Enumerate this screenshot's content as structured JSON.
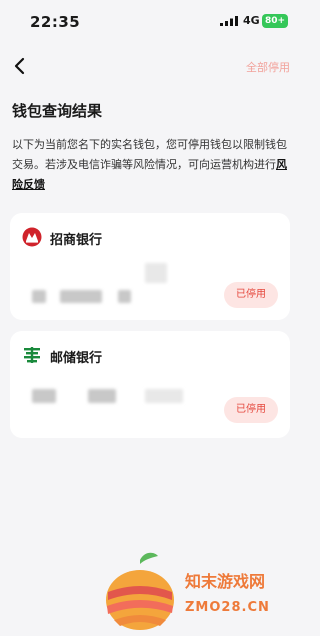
{
  "status_bar": {
    "time": "22:35",
    "network": "4G",
    "battery": "80+"
  },
  "nav": {
    "stop_all_label": "全部停用"
  },
  "page": {
    "title": "钱包查询结果",
    "description_text": "以下为当前您名下的实名钱包，您可停用钱包以限制钱包交易。若涉及电信诈骗等风险情况，可向运营机构进行",
    "feedback_link": "风险反馈"
  },
  "wallets": [
    {
      "bank_name": "招商银行",
      "logo_icon": "cmb-logo-icon",
      "stop_label": "已停用",
      "brand_color": "#d0232b"
    },
    {
      "bank_name": "邮储银行",
      "logo_icon": "psbc-logo-icon",
      "stop_label": "已停用",
      "brand_color": "#1a8a3c"
    }
  ],
  "watermark": {
    "name": "知末游戏网",
    "url": "ZMO28.CN"
  },
  "colors": {
    "accent_red": "#e5483d",
    "accent_light_red": "#f2a29b",
    "background": "#f5f5f7",
    "battery_green": "#35c759"
  }
}
